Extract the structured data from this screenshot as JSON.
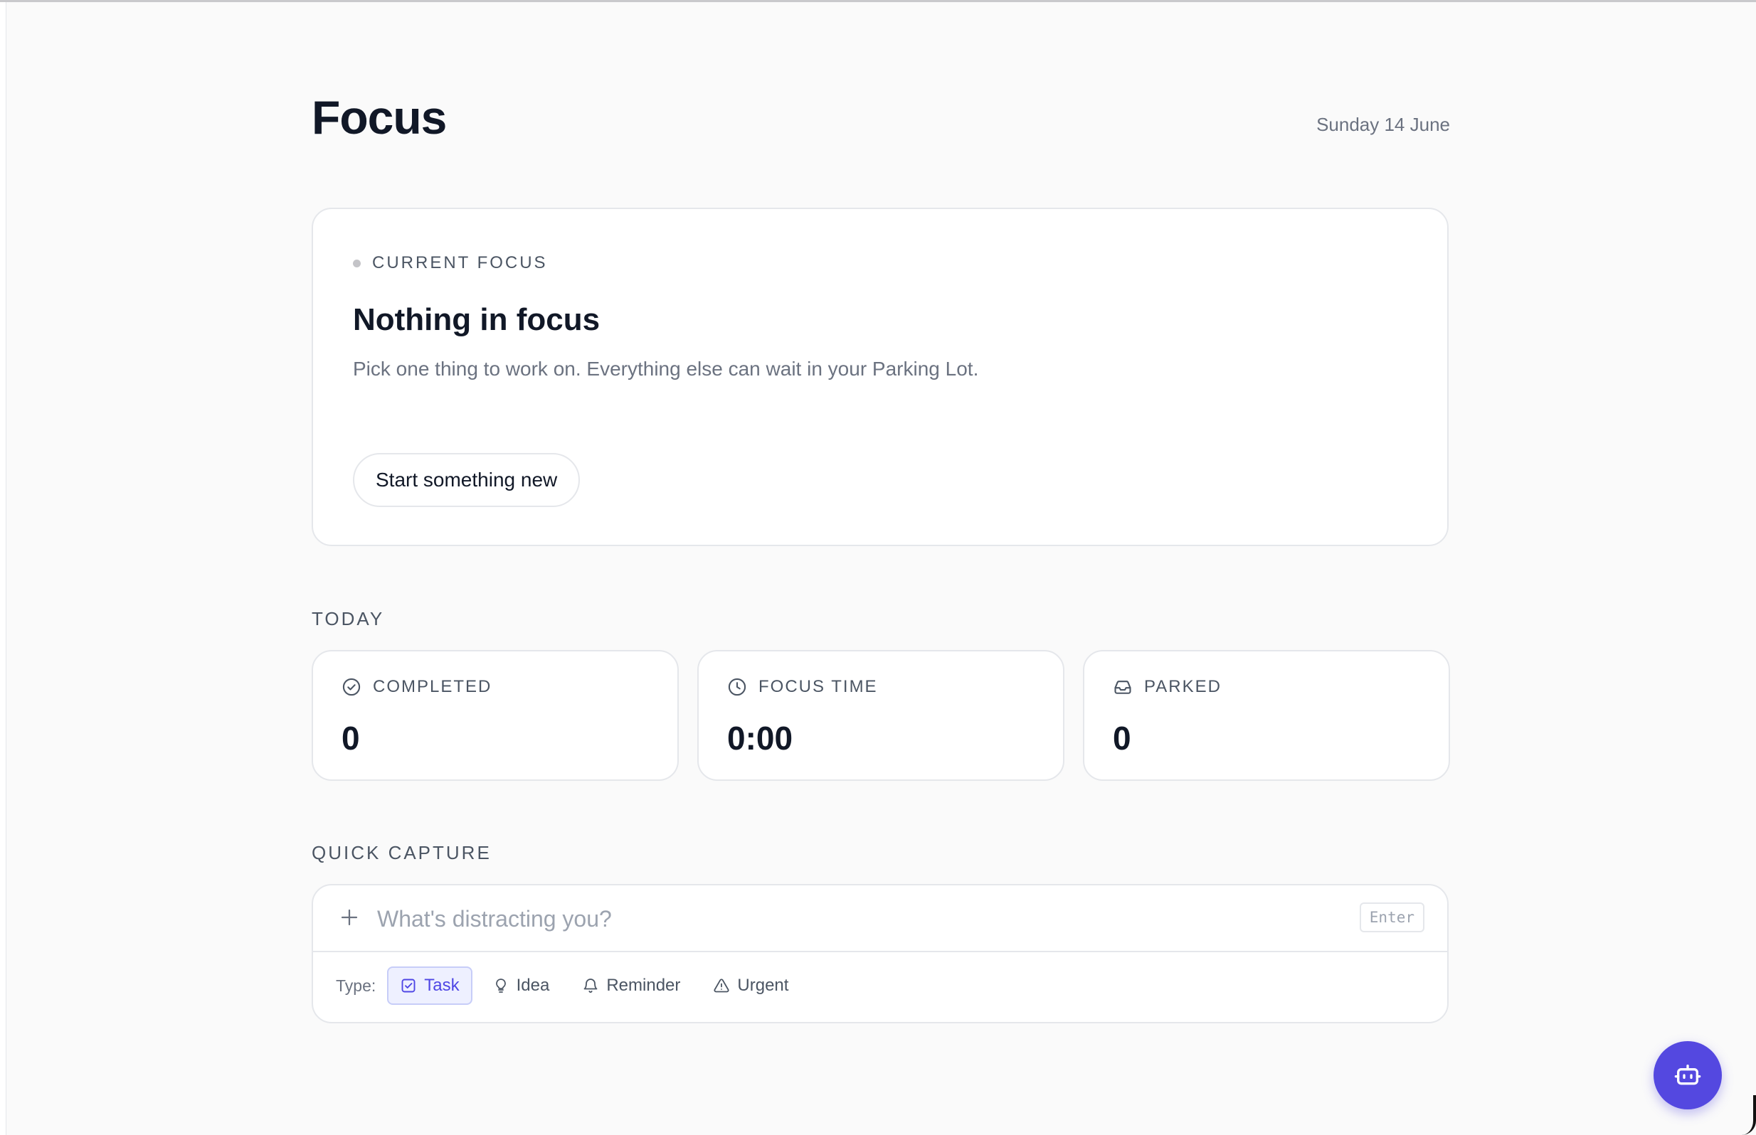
{
  "header": {
    "title": "Focus",
    "date": "Sunday 14 June"
  },
  "current_focus": {
    "label": "CURRENT FOCUS",
    "title": "Nothing in focus",
    "description": "Pick one thing to work on. Everything else can wait in your Parking Lot.",
    "button_label": "Start something new"
  },
  "today": {
    "label": "TODAY",
    "stats": [
      {
        "label": "COMPLETED",
        "value": "0",
        "icon": "check-circle-icon"
      },
      {
        "label": "FOCUS TIME",
        "value": "0:00",
        "icon": "clock-icon"
      },
      {
        "label": "PARKED",
        "value": "0",
        "icon": "inbox-icon"
      }
    ]
  },
  "quick_capture": {
    "label": "QUICK CAPTURE",
    "placeholder": "What's distracting you?",
    "value": "",
    "enter_hint": "Enter",
    "type_label": "Type:",
    "types": [
      {
        "label": "Task",
        "icon": "check-square-icon",
        "selected": true
      },
      {
        "label": "Idea",
        "icon": "lightbulb-icon",
        "selected": false
      },
      {
        "label": "Reminder",
        "icon": "bell-icon",
        "selected": false
      },
      {
        "label": "Urgent",
        "icon": "warning-icon",
        "selected": false
      }
    ]
  },
  "assistant": {
    "icon": "bot-icon"
  },
  "colors": {
    "accent": "#5448e0",
    "background": "#fafafa",
    "card": "#ffffff",
    "border": "#e5e7eb",
    "text_primary": "#111827",
    "text_muted": "#6b7280",
    "chip_active_bg": "#eef0ff",
    "chip_active_text": "#4f46e5"
  }
}
